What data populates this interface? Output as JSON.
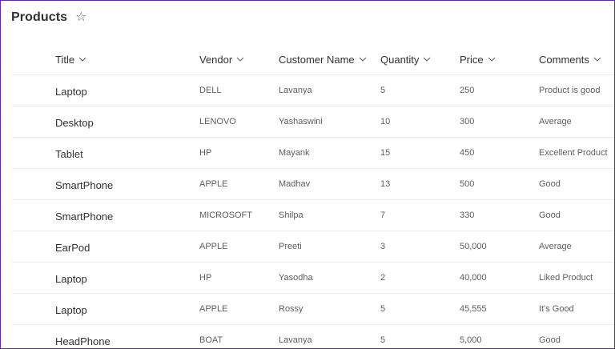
{
  "header": {
    "title": "Products",
    "star_icon": "☆"
  },
  "columns": [
    {
      "key": "title",
      "label": "Title"
    },
    {
      "key": "vendor",
      "label": "Vendor"
    },
    {
      "key": "customer",
      "label": "Customer Name"
    },
    {
      "key": "qty",
      "label": "Quantity"
    },
    {
      "key": "price",
      "label": "Price"
    },
    {
      "key": "comments",
      "label": "Comments"
    }
  ],
  "rows": [
    {
      "title": "Laptop",
      "vendor": "DELL",
      "customer": "Lavanya",
      "qty": "5",
      "price": "250",
      "comments": "Product is good"
    },
    {
      "title": "Desktop",
      "vendor": "LENOVO",
      "customer": "Yashaswini",
      "qty": "10",
      "price": "300",
      "comments": "Average"
    },
    {
      "title": "Tablet",
      "vendor": "HP",
      "customer": "Mayank",
      "qty": "15",
      "price": "450",
      "comments": "Excellent Product"
    },
    {
      "title": "SmartPhone",
      "vendor": "APPLE",
      "customer": "Madhav",
      "qty": "13",
      "price": "500",
      "comments": "Good"
    },
    {
      "title": "SmartPhone",
      "vendor": "MICROSOFT",
      "customer": "Shilpa",
      "qty": "7",
      "price": "330",
      "comments": "Good"
    },
    {
      "title": "EarPod",
      "vendor": "APPLE",
      "customer": "Preeti",
      "qty": "3",
      "price": "50,000",
      "comments": "Average"
    },
    {
      "title": "Laptop",
      "vendor": "HP",
      "customer": "Yasodha",
      "qty": "2",
      "price": "40,000",
      "comments": "Liked Product"
    },
    {
      "title": "Laptop",
      "vendor": "APPLE",
      "customer": "Rossy",
      "qty": "5",
      "price": "45,555",
      "comments": "It's Good"
    },
    {
      "title": "HeadPhone",
      "vendor": "BOAT",
      "customer": "Lavanya",
      "qty": "5",
      "price": "5,000",
      "comments": "Good"
    }
  ]
}
